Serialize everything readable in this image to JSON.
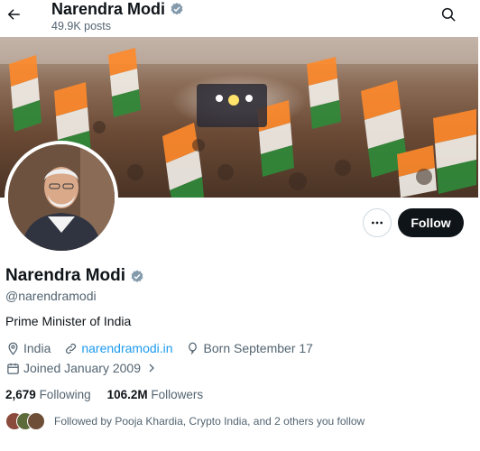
{
  "header": {
    "title": "Narendra Modi",
    "posts": "49.9K posts"
  },
  "profile": {
    "name": "Narendra Modi",
    "handle": "@narendramodi",
    "bio": "Prime Minister of India",
    "location": "India",
    "website": "narendramodi.in",
    "born": "Born September 17",
    "joined": "Joined January 2009"
  },
  "actions": {
    "follow_label": "Follow"
  },
  "stats": {
    "following_count": "2,679",
    "following_label": "Following",
    "followers_count": "106.2M",
    "followers_label": "Followers"
  },
  "followed_by": "Followed by Pooja Khardia, Crypto India, and 2 others you follow",
  "colors": {
    "accent": "#1d9bf0",
    "verified": "#829aab",
    "follow_bg": "#0f1419"
  },
  "icons": [
    "back-arrow-icon",
    "verified-icon",
    "search-icon",
    "more-icon",
    "location-icon",
    "link-icon",
    "balloon-icon",
    "calendar-icon",
    "chevron-right-icon"
  ]
}
